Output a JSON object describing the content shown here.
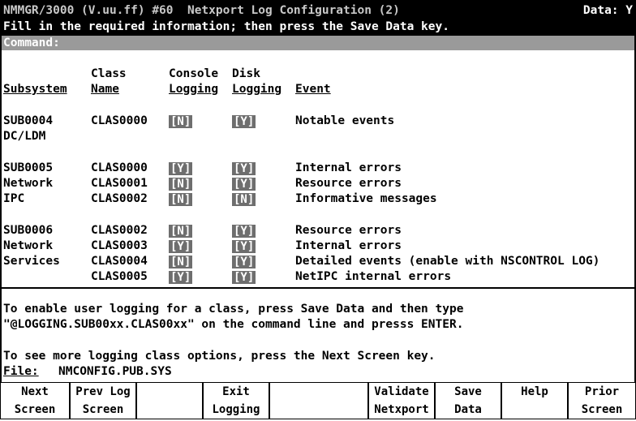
{
  "header": {
    "title": "NMMGR/3000 (V.uu.ff) #60  Netxport Log Configuration (2)",
    "data_indicator": "Data: Y"
  },
  "instruction": "Fill in the required information; then press the Save Data key.",
  "command_label": "Command:",
  "columns": {
    "class_top": "Class",
    "console_top": "Console",
    "disk_top": "Disk",
    "subsystem": "Subsystem",
    "class_name": "Name",
    "console_logging": "Logging",
    "disk_logging": "Logging",
    "event": "Event"
  },
  "groups": [
    {
      "subsystem_lines": [
        "SUB0004",
        "DC/LDM"
      ],
      "rows": [
        {
          "class": "CLAS0000",
          "console": "[N]",
          "disk": "[Y]",
          "event": "Notable events"
        }
      ]
    },
    {
      "subsystem_lines": [
        "SUB0005",
        "Network",
        "IPC"
      ],
      "rows": [
        {
          "class": "CLAS0000",
          "console": "[Y]",
          "disk": "[Y]",
          "event": "Internal errors"
        },
        {
          "class": "CLAS0001",
          "console": "[N]",
          "disk": "[Y]",
          "event": "Resource errors"
        },
        {
          "class": "CLAS0002",
          "console": "[N]",
          "disk": "[N]",
          "event": "Informative messages"
        }
      ]
    },
    {
      "subsystem_lines": [
        "SUB0006",
        "Network",
        "Services"
      ],
      "rows": [
        {
          "class": "CLAS0002",
          "console": "[N]",
          "disk": "[Y]",
          "event": "Resource errors"
        },
        {
          "class": "CLAS0003",
          "console": "[Y]",
          "disk": "[Y]",
          "event": "Internal errors"
        },
        {
          "class": "CLAS0004",
          "console": "[N]",
          "disk": "[Y]",
          "event": "Detailed events (enable with NSCONTROL LOG)"
        },
        {
          "class": "CLAS0005",
          "console": "[Y]",
          "disk": "[Y]",
          "event": "NetIPC internal errors"
        }
      ]
    }
  ],
  "notes": {
    "line1": "To enable user logging for a class, press Save Data and then type",
    "line2": "\"@LOGGING.SUB00xx.CLAS00xx\" on the command line and presss ENTER.",
    "line3": "To see more logging class options, press the Next Screen key."
  },
  "file": {
    "label": "File:",
    "value": "NMCONFIG.PUB.SYS"
  },
  "function_keys": [
    {
      "l1": "Next",
      "l2": "Screen"
    },
    {
      "l1": "Prev Log",
      "l2": "Screen"
    },
    {
      "l1": "",
      "l2": ""
    },
    {
      "l1": "Exit",
      "l2": "Logging"
    },
    {
      "l1": "",
      "l2": ""
    },
    {
      "l1": "Validate",
      "l2": "Netxport"
    },
    {
      "l1": "Save",
      "l2": "Data"
    },
    {
      "l1": "Help",
      "l2": ""
    },
    {
      "l1": "Prior",
      "l2": "Screen"
    }
  ]
}
